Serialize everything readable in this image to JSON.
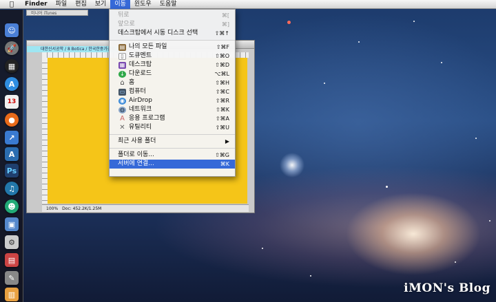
{
  "menubar": {
    "app_name": "Finder",
    "items": [
      "파일",
      "편집",
      "보기",
      "이동",
      "윈도우",
      "도움말"
    ],
    "active_item": "이동"
  },
  "itunes_tab": "미니어 iTunes",
  "bg_window": {
    "tab_label": "대한신서공학 / 8 Botica / 한국한중가공학",
    "status_zoom": "100%",
    "status_doc": "Doc: 452.2K/1.25M"
  },
  "go_menu": {
    "items": [
      {
        "label": "뒤로",
        "shortcut": "⌘[",
        "disabled": true
      },
      {
        "label": "앞으로",
        "shortcut": "⌘]",
        "disabled": true
      },
      {
        "label": "데스크탑에서 시동 디스크 선택",
        "shortcut": "⇧⌘↑"
      },
      {
        "label": "나의 모든 파일",
        "shortcut": "⇧⌘F",
        "icon": "all-files-icon"
      },
      {
        "label": "도큐멘트",
        "shortcut": "⇧⌘O",
        "icon": "documents-icon"
      },
      {
        "label": "데스크탑",
        "shortcut": "⇧⌘D",
        "icon": "desktop-icon"
      },
      {
        "label": "다운로드",
        "shortcut": "⌥⌘L",
        "icon": "downloads-icon"
      },
      {
        "label": "홈",
        "shortcut": "⇧⌘H",
        "icon": "home-icon"
      },
      {
        "label": "컴퓨터",
        "shortcut": "⇧⌘C",
        "icon": "computer-icon"
      },
      {
        "label": "AirDrop",
        "shortcut": "⇧⌘R",
        "icon": "airdrop-icon"
      },
      {
        "label": "네트워크",
        "shortcut": "⇧⌘K",
        "icon": "network-icon"
      },
      {
        "label": "응용 프로그램",
        "shortcut": "⇧⌘A",
        "icon": "applications-icon"
      },
      {
        "label": "유틸리티",
        "shortcut": "⇧⌘U",
        "icon": "utilities-icon"
      },
      {
        "label": "최근 사용 폴더",
        "shortcut": "▶"
      },
      {
        "label": "폴더로 이동...",
        "shortcut": "⇧⌘G"
      },
      {
        "label": "서버에 연결...",
        "shortcut": "⌘K",
        "highlighted": true
      }
    ]
  },
  "watermark": "iMON's Blog"
}
